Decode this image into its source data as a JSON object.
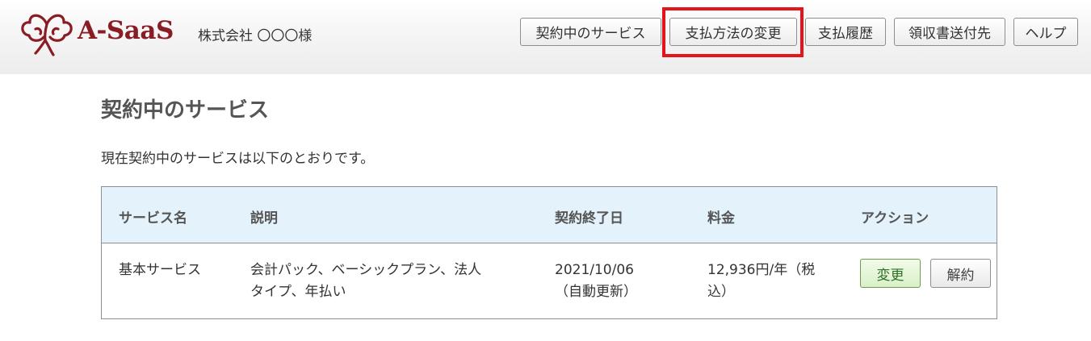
{
  "header": {
    "logo_text": "A-SaaS",
    "company_name": "株式会社 〇〇〇様",
    "nav": [
      {
        "label": "契約中のサービス"
      },
      {
        "label": "支払方法の変更"
      },
      {
        "label": "支払履歴"
      },
      {
        "label": "領収書送付先"
      },
      {
        "label": "ヘルプ"
      }
    ],
    "highlighted_nav": "支払方法の変更"
  },
  "main": {
    "title": "契約中のサービス",
    "intro": "現在契約中のサービスは以下のとおりです。",
    "table": {
      "headers": [
        "サービス名",
        "説明",
        "契約終了日",
        "料金",
        "アクション"
      ],
      "rows": [
        {
          "service_name": "基本サービス",
          "description_line1": "会計パック、ベーシックプラン、法人",
          "description_line2": "タイプ、年払い",
          "end_date_line1": "2021/10/06",
          "end_date_line2": "（自動更新）",
          "price_line1": "12,936円/年（税",
          "price_line2": "込）",
          "actions": {
            "change": "変更",
            "cancel": "解約"
          }
        }
      ]
    }
  },
  "colors": {
    "brand": "#8a1c24",
    "highlight": "#e3141c",
    "table_header_bg": "#e3f2fb",
    "change_button_bg": "#daf0c8"
  },
  "icons": {
    "logo": "cotton-plant-icon"
  }
}
